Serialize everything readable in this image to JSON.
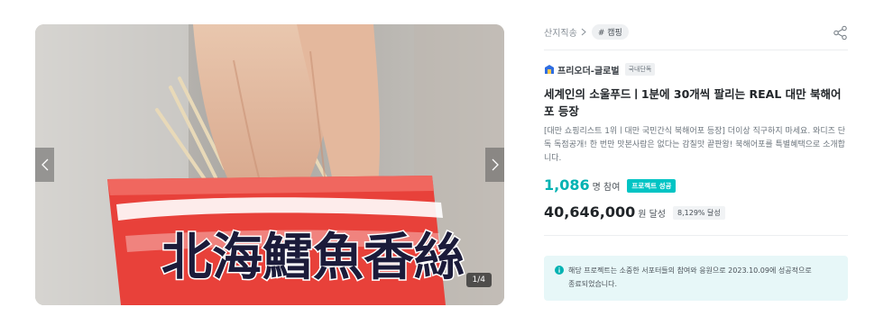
{
  "gallery": {
    "page_counter": "1/4",
    "product_text": "北海鱈魚香絲"
  },
  "breadcrumb": {
    "category": "산지직송",
    "tag": "# 캠핑"
  },
  "maker": {
    "name": "프리오더-글로벌",
    "badge": "국내단독"
  },
  "project": {
    "title": "세계인의 소울푸드ㅣ1분에 30개씩 팔리는 REAL 대만 북해어포 등장",
    "summary": "[대만 쇼핑리스트 1위ㅣ대만 국민간식 북해어포 등장] 더이상 직구하지 마세요. 와디즈 단독 독점공개! 한 번만 맛본사람은 없다는 감칠맛 끝판왕! 북해어포를 특별혜택으로 소개합니다."
  },
  "stats": {
    "participants": "1,086",
    "participants_unit": "명 참여",
    "success_badge": "프로젝트 성공",
    "amount": "40,646,000",
    "amount_unit": "원 달성",
    "percent_badge": "8,129% 달성"
  },
  "notice": {
    "line1": "해당 프로젝트는 소중한 서포터들의 참여와 응원으로 2023.10.09에 성공적으로",
    "line2": "종료되었습니다."
  },
  "colors": {
    "accent": "#00b2b2",
    "success_badge": "#00c4c4",
    "notice_bg": "#e7f7f8",
    "maker_icon": "#2f6de1"
  },
  "icons": {
    "share": "share-icon",
    "prev": "chevron-left-icon",
    "next": "chevron-right-icon",
    "crumb": "chevron-right-icon",
    "maker": "maker-logo-icon",
    "notice": "info-icon"
  }
}
